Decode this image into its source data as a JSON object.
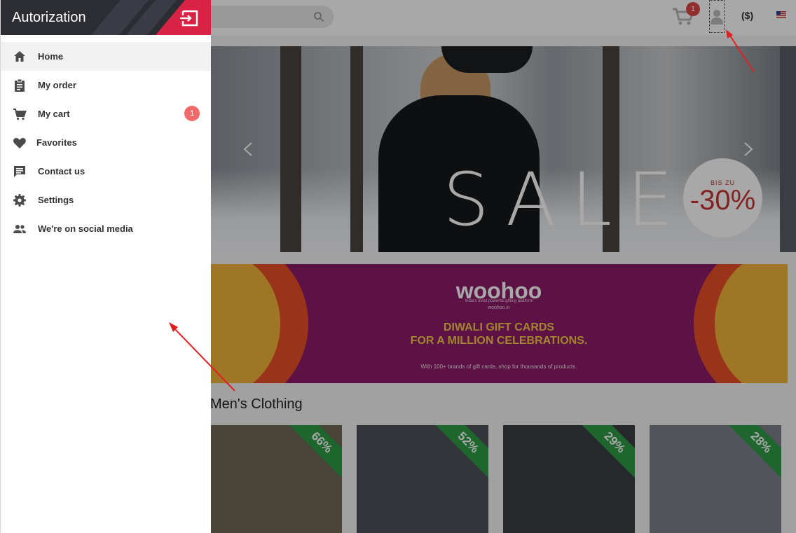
{
  "header": {
    "cart_count": "1",
    "currency": "($)"
  },
  "slider": {
    "text": "SALE",
    "discount_small": "BIS ZU",
    "discount_big": "-30%"
  },
  "banner": {
    "logo": "woohoo",
    "tagline": "India's most powerful gifting platform",
    "site": "woohoo.in",
    "title_line1": "DIWALI GIFT CARDS",
    "title_line2": "FOR A MILLION CELEBRATIONS.",
    "footer": "With 100+ brands of gift cards, shop for thousands of products."
  },
  "section": {
    "title": "Men's Clothing"
  },
  "products": [
    {
      "discount": "66%"
    },
    {
      "discount": "52%"
    },
    {
      "discount": "29%"
    },
    {
      "discount": "28%"
    }
  ],
  "drawer": {
    "title": "Autorization",
    "menu": [
      {
        "label": "Home",
        "icon": "home-icon"
      },
      {
        "label": "My order",
        "icon": "clipboard-icon"
      },
      {
        "label": "My cart",
        "icon": "cart-icon",
        "badge": "1"
      },
      {
        "label": "Favorites",
        "icon": "heart-icon"
      },
      {
        "label": "Contact us",
        "icon": "chat-icon"
      },
      {
        "label": "Settings",
        "icon": "gear-icon"
      },
      {
        "label": "We're on social media",
        "icon": "people-icon"
      }
    ]
  },
  "colors": {
    "accent": "#d92344",
    "badge": "#f06a6a",
    "header_bg": "#2b2d33",
    "ribbon": "#2e9b46",
    "banner_bg": "#8e1c6a"
  }
}
